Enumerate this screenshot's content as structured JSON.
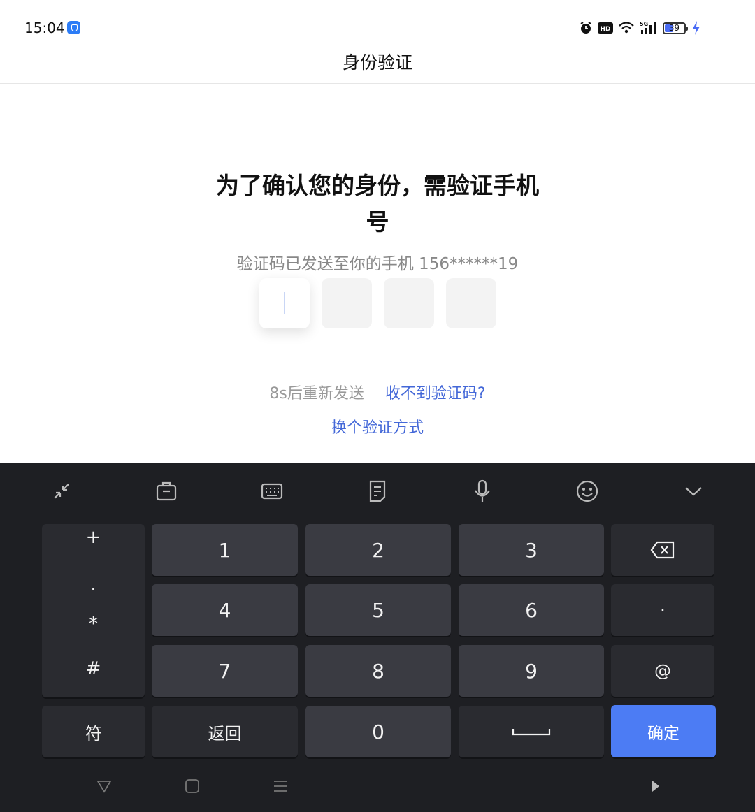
{
  "status_bar": {
    "time": "15:04",
    "battery_level": "39",
    "icons": [
      "shield-app-icon",
      "alarm-icon",
      "hd-icon",
      "wifi-icon",
      "signal-5g-icon",
      "battery-icon",
      "charging-icon"
    ]
  },
  "header": {
    "title": "身份验证"
  },
  "main": {
    "headline": "为了确认您的身份，需验证手机号",
    "subtext": "验证码已发送至你的手机 156******19",
    "code_length": 4,
    "resend_timer": "8s后重新发送",
    "no_code_link": "收不到验证码?",
    "switch_method_link": "换个验证方式"
  },
  "keyboard": {
    "toolbar_icons": [
      "collapse-icon",
      "clipboard-icon",
      "keyboard-icon",
      "notes-icon",
      "microphone-icon",
      "emoji-icon",
      "hide-keyboard-icon"
    ],
    "symbols": [
      "+",
      ".",
      "*",
      "#"
    ],
    "digits": [
      "1",
      "2",
      "3",
      "4",
      "5",
      "6",
      "7",
      "8",
      "9",
      "0"
    ],
    "dot_key": "·",
    "at_key": "@",
    "symbol_key": "符",
    "back_key": "返回",
    "confirm_key": "确定",
    "colors": {
      "accent": "#4c7cf4",
      "background": "#1e1f23",
      "key": "#3a3b42"
    }
  },
  "nav_bar": {
    "icons": [
      "back-triangle-icon",
      "home-square-icon",
      "recents-menu-icon",
      "play-icon"
    ]
  }
}
